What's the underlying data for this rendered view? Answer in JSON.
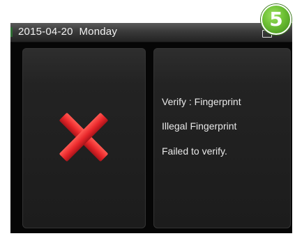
{
  "header": {
    "date": "2015-04-20",
    "weekday": "Monday",
    "status_icon": "monitor-icon"
  },
  "result": {
    "icon": "red-x-icon",
    "icon_color": "#e8262a",
    "line1": "Verify : Fingerprint",
    "line2": "Illegal Fingerprint",
    "line3": "Failed to verify."
  },
  "step_badge": {
    "number": "5",
    "color": "#6cbf33"
  }
}
